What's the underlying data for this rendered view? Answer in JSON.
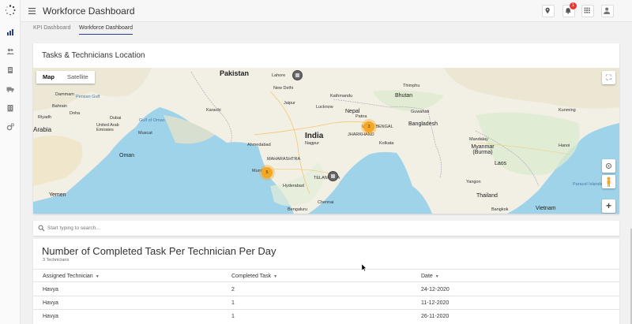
{
  "app": {
    "title": "Workforce Dashboard",
    "notification_count": "1"
  },
  "tabs": [
    {
      "label": "KPI Dashboard",
      "active": false
    },
    {
      "label": "Workforce Dashboard",
      "active": true
    }
  ],
  "map_card": {
    "title": "Tasks & Technicians Location",
    "map_type": {
      "options": [
        "Map",
        "Satellite"
      ],
      "selected": "Map"
    },
    "countries": [
      "Pakistan",
      "India",
      "Oman",
      "Yemen",
      "Nepal",
      "Bhutan",
      "Bangladesh",
      "Myanmar (Burma)",
      "Laos",
      "Thailand",
      "Vietnam"
    ],
    "places": [
      "Lahore",
      "New Delhi",
      "Jaipur",
      "Lucknow",
      "Karachi",
      "Ahmedabad",
      "Kolkata",
      "Mumbai",
      "Hyderabad",
      "Bengaluru",
      "Nagpur",
      "Dammam",
      "Doha",
      "Bahrain",
      "Riyadh",
      "Dubai",
      "United Arab Emirates",
      "Muscat",
      "Kunming",
      "Mandalay",
      "Hanoi",
      "Bangkok",
      "Yangon",
      "Patna",
      "Guwahati",
      "Chennai",
      "MAHARASHTRA",
      "TELANGANA",
      "JHARKHAND",
      "WEST BENGAL",
      "Arabia",
      "Persian Gulf",
      "Gulf of Oman",
      "Paracel Islands",
      "Kathmandu",
      "Thimphu"
    ],
    "clusters": [
      {
        "count": "3"
      },
      {
        "count": "5"
      }
    ],
    "controls": {
      "zoom_in": "+",
      "fullscreen": "⛶"
    }
  },
  "search": {
    "placeholder": "Start typing to search...",
    "value": ""
  },
  "table": {
    "title": "Number of Completed Task Per Technician Per Day",
    "subtitle": "3 Technicians",
    "columns": [
      "Assigned Technician",
      "Completed Task",
      "Date"
    ],
    "rows": [
      [
        "Havya",
        "2",
        "24-12-2020"
      ],
      [
        "Havya",
        "1",
        "11-12-2020"
      ],
      [
        "Havya",
        "1",
        "26-11-2020"
      ]
    ]
  },
  "colors": {
    "accent": "#2c3e90",
    "badge": "#e53935",
    "cluster": "#f5a623",
    "water": "#9fd3ea",
    "land": "#f2efe4"
  },
  "icons": [
    "app-logo-icon",
    "menu-icon",
    "location-pin-icon",
    "bell-icon",
    "apps-grid-icon",
    "user-icon",
    "chart-icon",
    "users-icon",
    "document-icon",
    "truck-icon",
    "building-icon",
    "settings-icon",
    "search-icon"
  ]
}
